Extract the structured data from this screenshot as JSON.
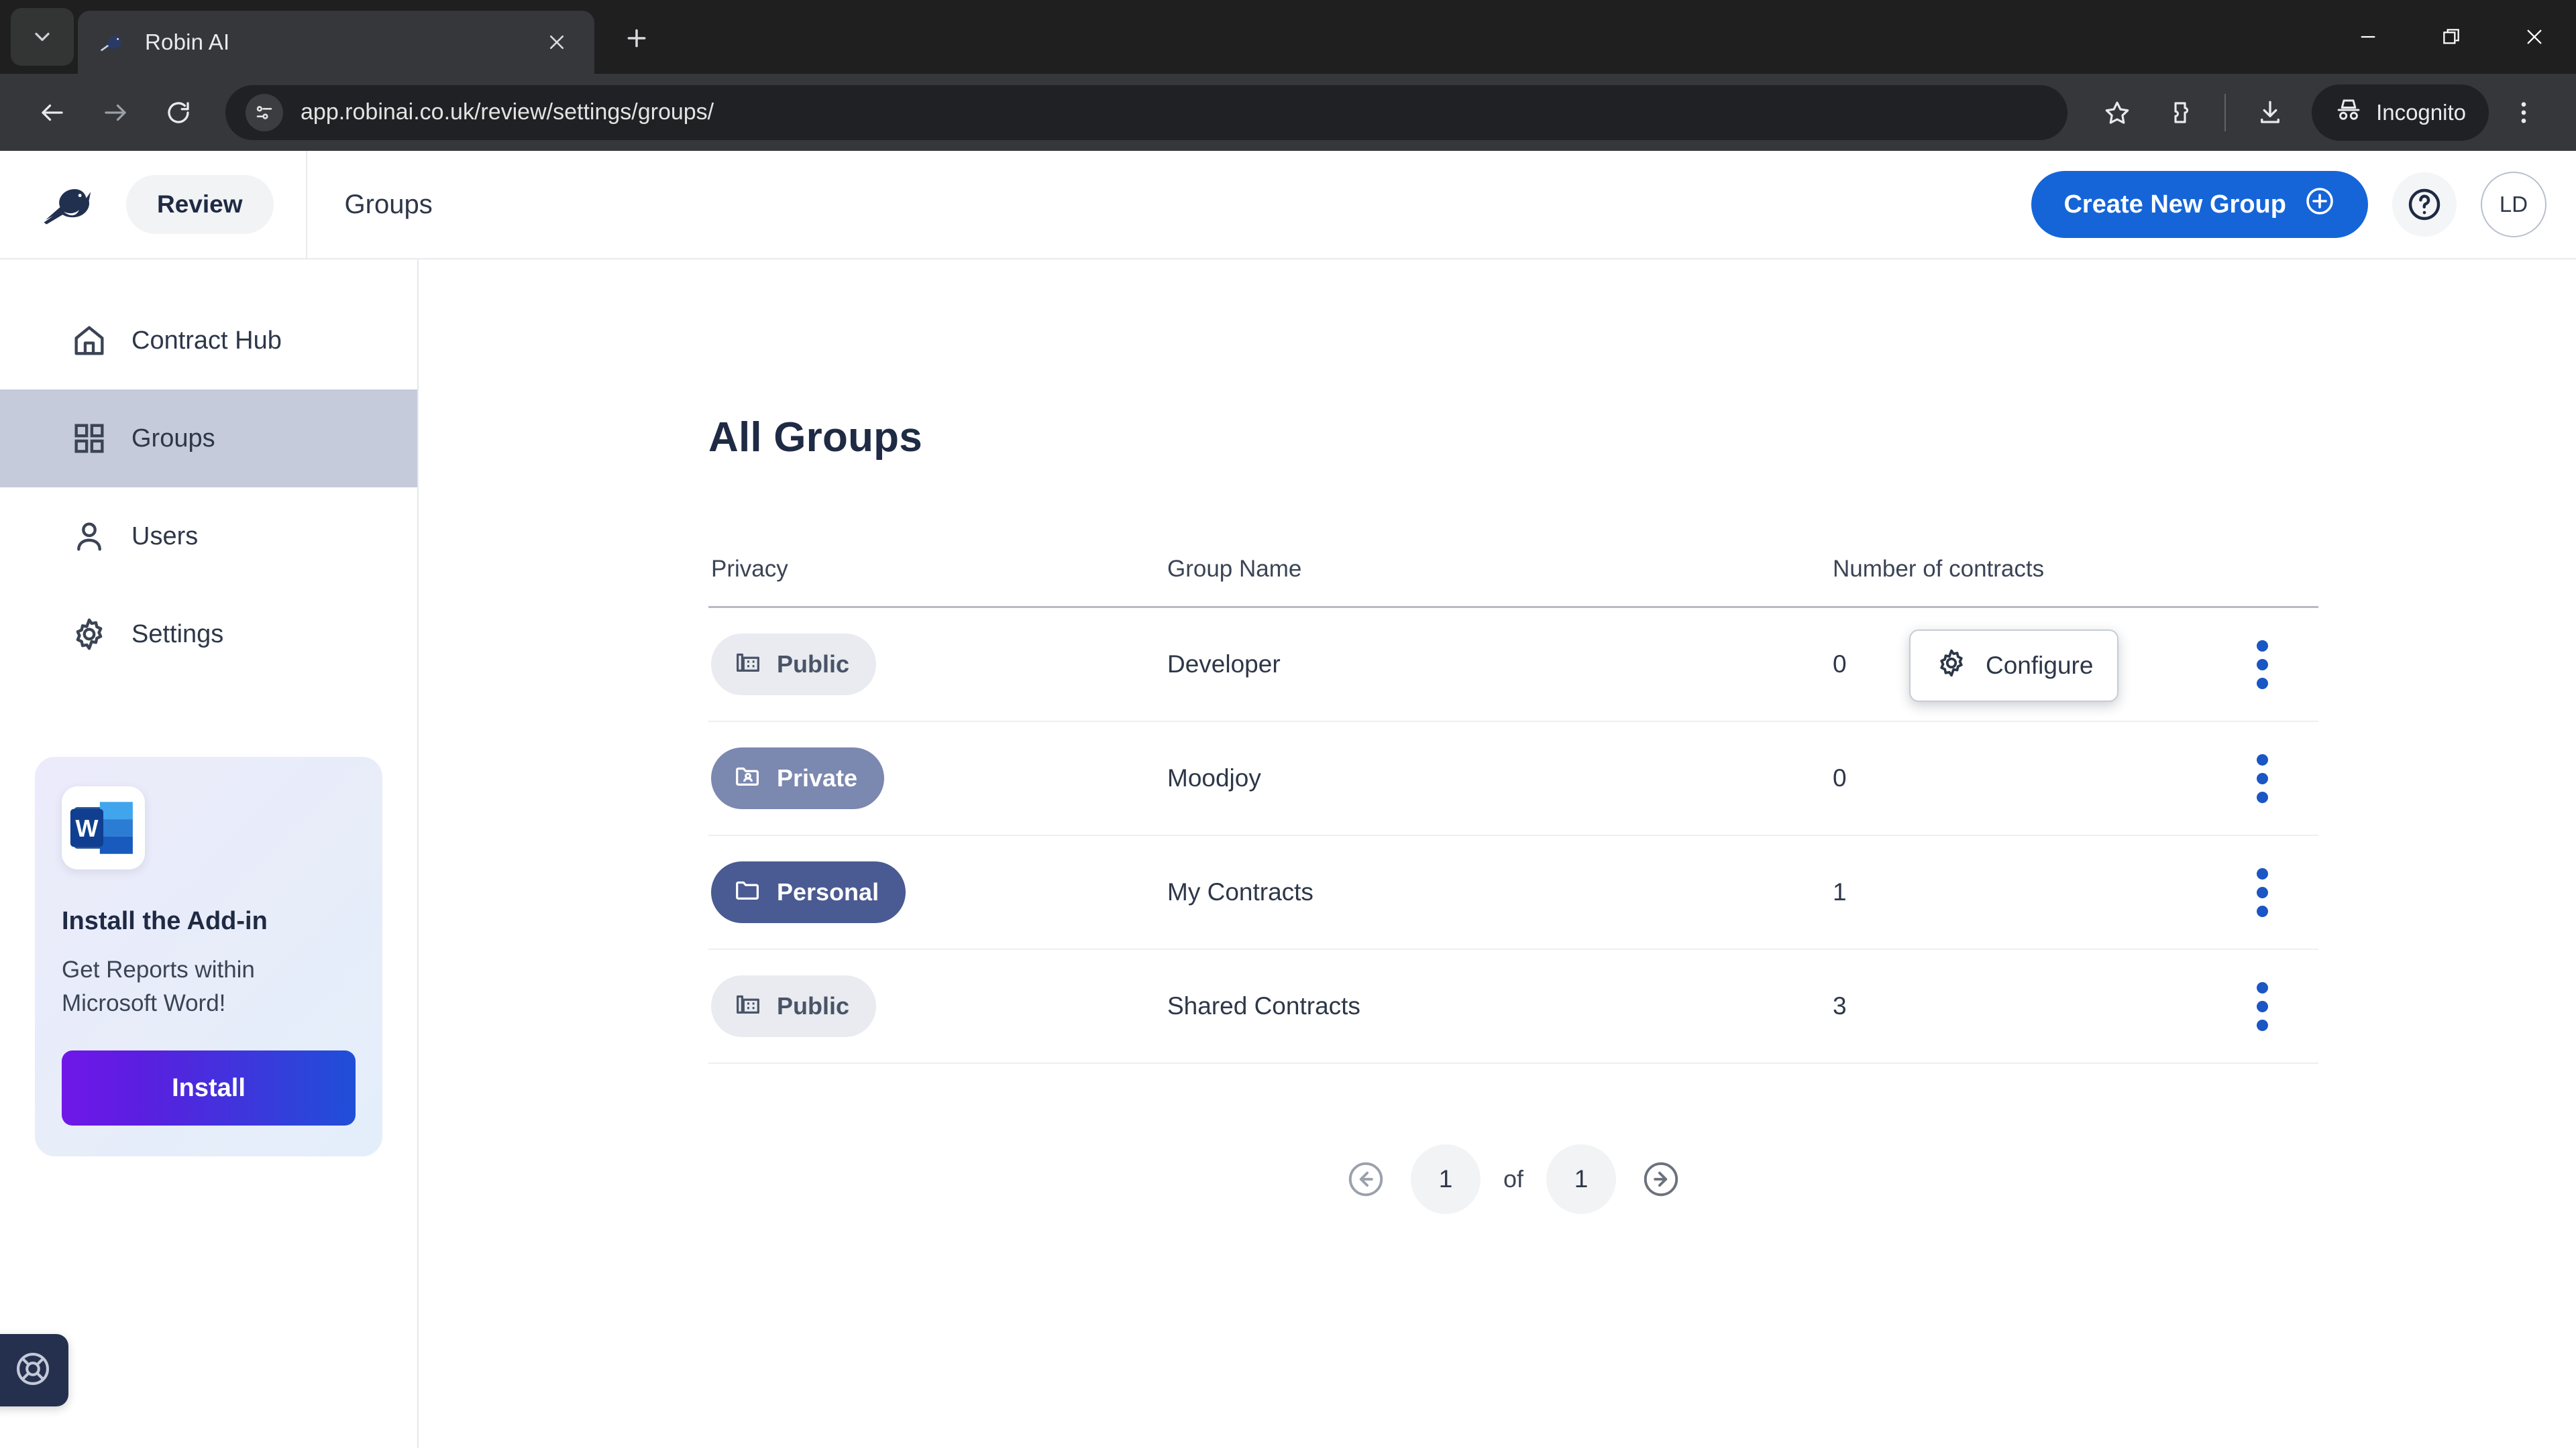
{
  "browser": {
    "tab_search_icon": "chevron-down-icon",
    "tab": {
      "title": "Robin AI",
      "favicon": "robin-bird-favicon",
      "close_icon": "close-icon"
    },
    "new_tab_icon": "plus-icon",
    "window_controls": {
      "minimize": "minimize-icon",
      "maximize": "restore-icon",
      "close": "close-icon"
    },
    "nav": {
      "back": "back-arrow-icon",
      "forward": "forward-arrow-icon",
      "reload": "reload-icon"
    },
    "omnibox": {
      "site_info_icon": "page-info-icon",
      "url": "app.robinai.co.uk/review/settings/groups/"
    },
    "actions": {
      "bookmark": "star-icon",
      "extensions": "extensions-icon",
      "downloads": "download-icon",
      "incognito_label": "Incognito",
      "incognito_icon": "incognito-hat-icon",
      "menu": "three-dot-menu-icon"
    }
  },
  "app": {
    "logo": "robin-bird-logo",
    "workspace_label": "Review",
    "page_title": "Groups",
    "create_button": {
      "label": "Create New Group",
      "icon": "plus-circle-icon",
      "color": "#1565d8"
    },
    "help_icon": "help-circle-icon",
    "avatar_initials": "LD"
  },
  "sidebar": {
    "items": [
      {
        "label": "Contract Hub",
        "icon": "home-icon",
        "active": false
      },
      {
        "label": "Groups",
        "icon": "grid-icon",
        "active": true
      },
      {
        "label": "Users",
        "icon": "user-icon",
        "active": false
      },
      {
        "label": "Settings",
        "icon": "gear-icon",
        "active": false
      }
    ],
    "promo": {
      "icon": "microsoft-word-icon",
      "title": "Install the Add-in",
      "subtitle": "Get Reports within Microsoft Word!",
      "button_label": "Install"
    },
    "support_icon": "lifebuoy-icon"
  },
  "main": {
    "heading": "All Groups",
    "columns": [
      "Privacy",
      "Group Name",
      "Number of contracts"
    ],
    "rows": [
      {
        "privacy": "Public",
        "privacy_icon": "building-icon",
        "name": "Developer",
        "contracts": "0",
        "menu_icon": "three-dot-menu-icon"
      },
      {
        "privacy": "Private",
        "privacy_icon": "folder-person-icon",
        "name": "Moodjoy",
        "contracts": "0",
        "menu_icon": "three-dot-menu-icon"
      },
      {
        "privacy": "Personal",
        "privacy_icon": "folder-icon",
        "name": "My Contracts",
        "contracts": "1",
        "menu_icon": "three-dot-menu-icon"
      },
      {
        "privacy": "Public",
        "privacy_icon": "building-icon",
        "name": "Shared Contracts",
        "contracts": "3",
        "menu_icon": "three-dot-menu-icon"
      }
    ],
    "context_menu": {
      "label": "Configure",
      "icon": "gear-icon"
    },
    "pagination": {
      "prev_icon": "circle-left-arrow-icon",
      "current_page": "1",
      "of_label": "of",
      "total_pages": "1",
      "next_icon": "circle-right-arrow-icon"
    }
  }
}
